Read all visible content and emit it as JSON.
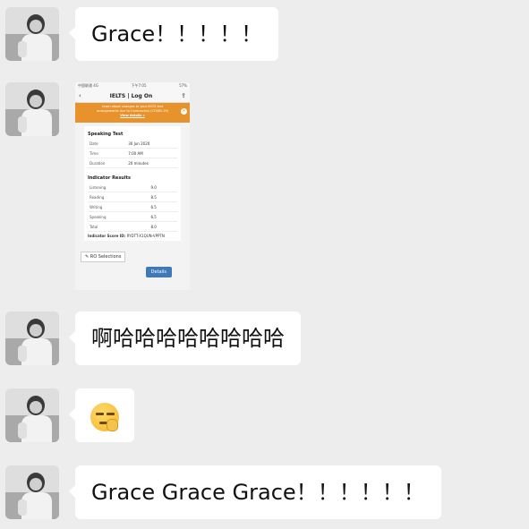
{
  "messages": [
    {
      "type": "text",
      "text": "Grace！！！！！"
    },
    {
      "type": "image"
    },
    {
      "type": "text",
      "text": "啊哈哈哈哈哈哈哈哈"
    },
    {
      "type": "emoji",
      "icon": "smirk-emoji-icon"
    },
    {
      "type": "text",
      "text": "Grace Grace Grace！！！！！！"
    }
  ],
  "screenshot": {
    "status_left": "中国联通 4G",
    "status_time": "下午7:05",
    "status_right": "57%",
    "title": "IELTS | Log On",
    "banner_line1": "Learn about changes to your IELTS test",
    "banner_line2": "arrangements due to Coronavirus (COVID-19)",
    "banner_link": "View details »",
    "speaking_heading": "Speaking Test",
    "speaking_rows": [
      {
        "label": "Date",
        "value": "30 Jun 2020"
      },
      {
        "label": "Time",
        "value": "7:00 AM"
      },
      {
        "label": "Duration",
        "value": "20 minutes"
      }
    ],
    "indicator_heading": "Indicator Results",
    "indicator_rows": [
      {
        "label": "Listening",
        "value": "9.0"
      },
      {
        "label": "Reading",
        "value": "8.5"
      },
      {
        "label": "Writing",
        "value": "6.5"
      },
      {
        "label": "Speaking",
        "value": "6.5"
      },
      {
        "label": "Total",
        "value": "8.0"
      }
    ],
    "indicator_id_label": "Indicator Score ID:",
    "indicator_id_value": "RYDTT-X1QUN-VPPTN",
    "ro_button": "RO Selections",
    "details_button": "Details"
  }
}
